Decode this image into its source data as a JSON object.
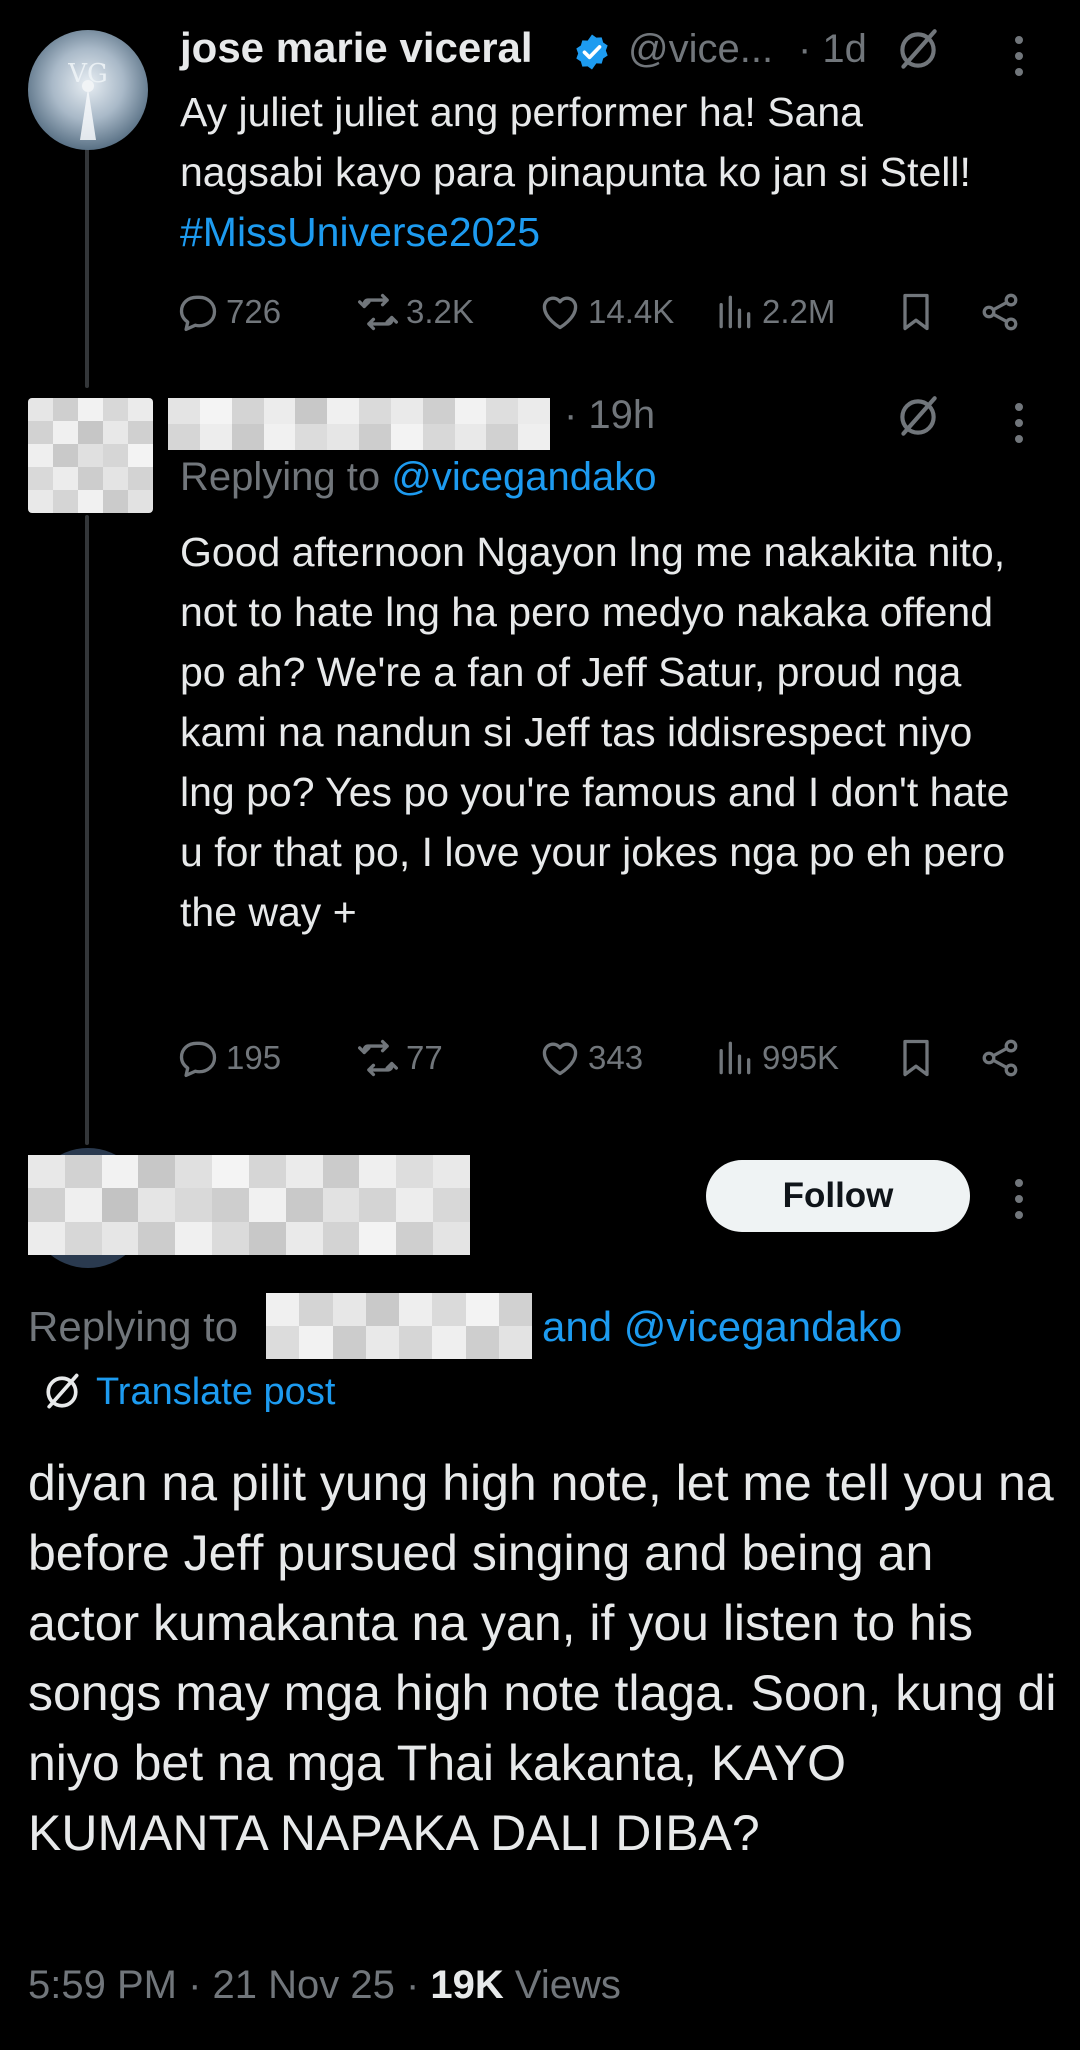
{
  "tweet1": {
    "name": "jose marie viceral",
    "handle": "@vice...",
    "time": "· 1d",
    "text": "Ay juliet juliet ang performer ha! Sana nagsabi kayo para pinapunta ko jan si Stell! ",
    "hashtag": "#MissUniverse2025",
    "replies": "726",
    "reposts": "3.2K",
    "likes": "14.4K",
    "views": "2.2M"
  },
  "tweet2": {
    "time": "· 19h",
    "replying_prefix": "Replying to ",
    "replying_handle": "@vicegandako",
    "text": "Good afternoon Ngayon lng me nakakita nito, not to hate lng ha pero medyo nakaka offend po ah? We're a fan of Jeff Satur, proud nga kami na nandun si Jeff tas iddisrespect niyo lng po? Yes po you're famous and I don't hate u for that po, I love your jokes nga po eh pero the way +",
    "replies": "195",
    "reposts": "77",
    "likes": "343",
    "views": "995K"
  },
  "main": {
    "follow_label": "Follow",
    "replying_prefix": "Replying to",
    "replying_suffix": "and @vicegandako",
    "translate_label": "Translate post",
    "text": "diyan na pilit  yung high note, let me tell you na before Jeff pursued singing and being an actor kumakanta na yan, if you listen to his songs may mga high note tlaga. Soon, kung di niyo bet na mga Thai kakanta, KAYO KUMANTA NAPAKA DALI DIBA?",
    "time": "5:59 PM",
    "date": "21 Nov 25",
    "views_count": "19K",
    "views_label": "Views"
  },
  "colors": {
    "accent": "#1d9bf0",
    "muted": "#71767b",
    "text": "#e7e9ea",
    "background": "#000000"
  }
}
